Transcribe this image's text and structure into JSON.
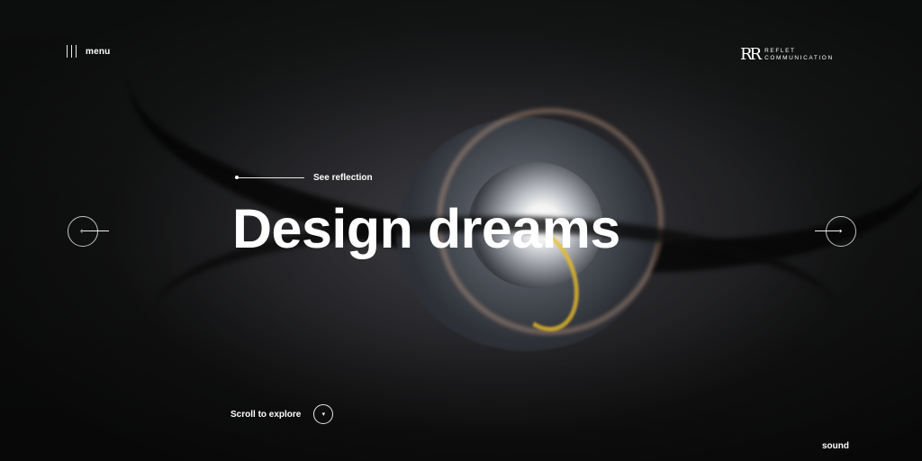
{
  "header": {
    "menu_label": "menu",
    "brand_logo": "RR",
    "brand_line1": "REFLET",
    "brand_line2": "COMMUNICATION"
  },
  "hero": {
    "link_label": "See reflection",
    "headline": "Design dreams",
    "scroll_label": "Scroll to explore",
    "sound_label": "sound"
  },
  "icons": {
    "menu": "three-vertical-bars-icon",
    "prev": "arrow-left-icon",
    "next": "arrow-right-icon",
    "scroll": "chevron-down-icon"
  },
  "colors": {
    "text": "#ffffff",
    "background": "#141414",
    "accent_glow": "#ebbe28"
  }
}
